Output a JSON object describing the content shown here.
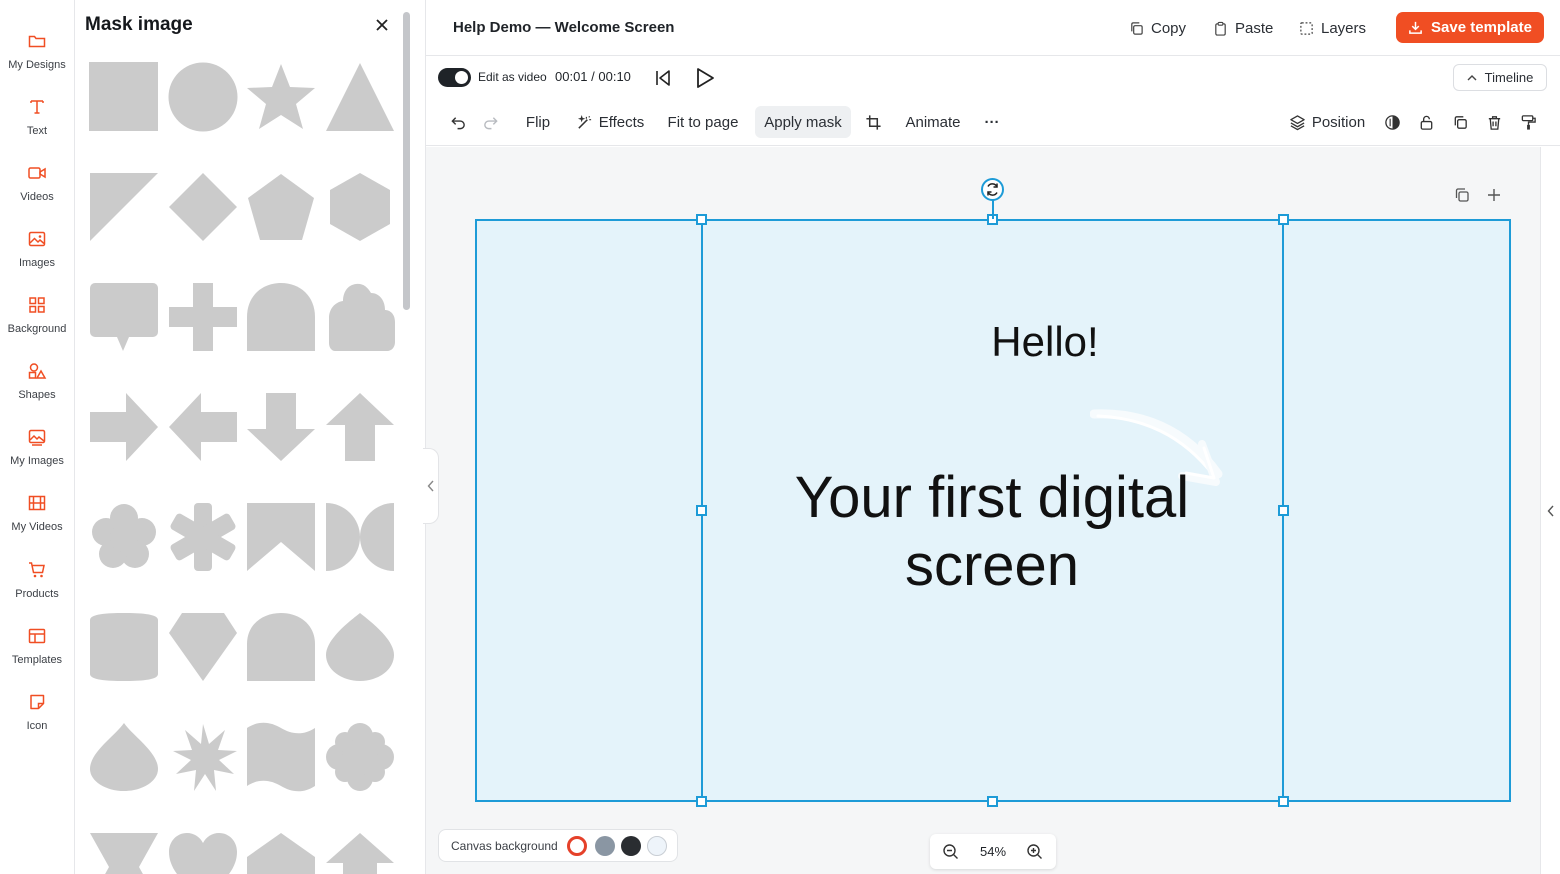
{
  "rail": {
    "items": [
      {
        "label": "My Designs",
        "icon": "folder-icon"
      },
      {
        "label": "Text",
        "icon": "text-icon"
      },
      {
        "label": "Videos",
        "icon": "video-camera-icon"
      },
      {
        "label": "Images",
        "icon": "image-icon"
      },
      {
        "label": "Background",
        "icon": "grid-icon"
      },
      {
        "label": "Shapes",
        "icon": "shapes-icon"
      },
      {
        "label": "My Images",
        "icon": "image-stack-icon"
      },
      {
        "label": "My Videos",
        "icon": "film-icon"
      },
      {
        "label": "Products",
        "icon": "cart-icon"
      },
      {
        "label": "Templates",
        "icon": "layout-icon"
      },
      {
        "label": "Icon",
        "icon": "sticker-icon"
      }
    ],
    "accent_color": "#f04e23"
  },
  "panel": {
    "title": "Mask image",
    "shape_color": "#cbcbcb"
  },
  "topbar": {
    "doc_title": "Help Demo — Welcome Screen",
    "copy_label": "Copy",
    "paste_label": "Paste",
    "layers_label": "Layers",
    "save_label": "Save template",
    "save_color": "#f04e23"
  },
  "video": {
    "edit_as_video_label": "Edit as video",
    "edit_as_video_on": true,
    "time": "00:01 / 00:10",
    "timeline_label": "Timeline"
  },
  "toolbar": {
    "flip": "Flip",
    "effects": "Effects",
    "fit_to_page": "Fit to page",
    "apply_mask": "Apply mask",
    "animate": "Animate",
    "more": "···",
    "position": "Position"
  },
  "canvas": {
    "hello": "Hello!",
    "headline": "Your first digital screen",
    "background_color": "#e4f3fa",
    "selection_color": "#1d9bd7"
  },
  "bottom": {
    "canvas_background_label": "Canvas background",
    "swatches": [
      "#ffffff",
      "#8a96a3",
      "#2a2d31",
      "#eef4fa"
    ],
    "zoom": "54%"
  }
}
